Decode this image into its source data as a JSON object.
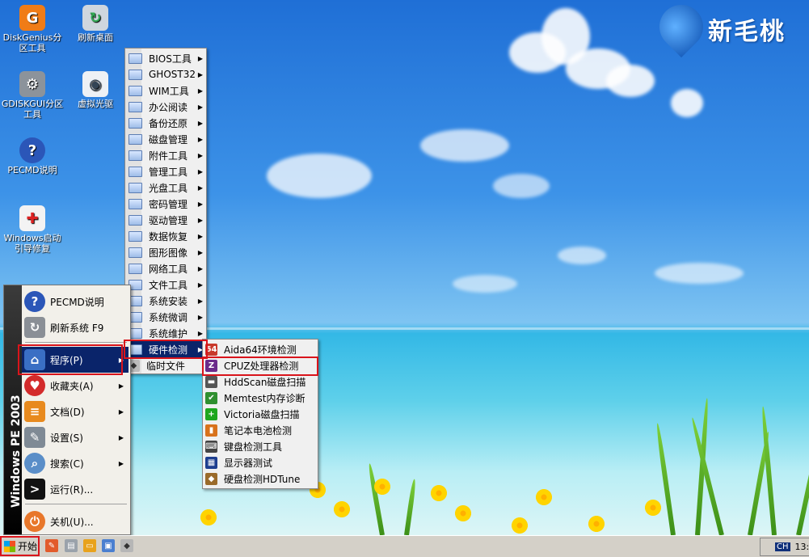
{
  "brand": {
    "text": "新毛桃"
  },
  "desktop_icons": [
    {
      "label": "DiskGenius分区工具",
      "icon": "diskgenius-icon"
    },
    {
      "label": "刷新桌面",
      "icon": "refresh-desktop-icon"
    },
    {
      "label": "GDISKGUI分区工具",
      "icon": "gdisk-icon"
    },
    {
      "label": "虚拟光驱",
      "icon": "virtual-drive-icon"
    },
    {
      "label": "PECMD说明",
      "icon": "help-icon"
    },
    {
      "label": "Windows启动引导修复",
      "icon": "boot-repair-icon"
    }
  ],
  "start_menu": {
    "banner": "Windows PE 2003",
    "items": [
      {
        "label": "PECMD说明",
        "icon": "help-icon",
        "submenu": false
      },
      {
        "label": "刷新系统 F9",
        "icon": "refresh-system-icon",
        "submenu": false
      },
      {
        "label": "程序(P)",
        "icon": "programs-icon",
        "submenu": true
      },
      {
        "label": "收藏夹(A)",
        "icon": "favorites-icon",
        "submenu": true
      },
      {
        "label": "文档(D)",
        "icon": "documents-icon",
        "submenu": true
      },
      {
        "label": "设置(S)",
        "icon": "settings-icon",
        "submenu": true
      },
      {
        "label": "搜索(C)",
        "icon": "search-icon",
        "submenu": true
      },
      {
        "label": "运行(R)...",
        "icon": "run-icon",
        "submenu": false
      },
      {
        "label": "关机(U)...",
        "icon": "shutdown-icon",
        "submenu": false
      }
    ]
  },
  "programs_menu": {
    "items": [
      {
        "label": "BIOS工具"
      },
      {
        "label": "GHOST32"
      },
      {
        "label": "WIM工具"
      },
      {
        "label": "办公阅读"
      },
      {
        "label": "备份还原"
      },
      {
        "label": "磁盘管理"
      },
      {
        "label": "附件工具"
      },
      {
        "label": "管理工具"
      },
      {
        "label": "光盘工具"
      },
      {
        "label": "密码管理"
      },
      {
        "label": "驱动管理"
      },
      {
        "label": "数据恢复"
      },
      {
        "label": "图形图像"
      },
      {
        "label": "网络工具"
      },
      {
        "label": "文件工具"
      },
      {
        "label": "系统安装"
      },
      {
        "label": "系统微调"
      },
      {
        "label": "系统维护"
      },
      {
        "label": "硬件检测"
      },
      {
        "label": "临时文件"
      }
    ]
  },
  "hardware_menu": {
    "items": [
      {
        "label": "Aida64环境检测",
        "icon": "aida64-icon",
        "glyph": "64"
      },
      {
        "label": "CPUZ处理器检测",
        "icon": "cpuz-icon",
        "glyph": "Z"
      },
      {
        "label": "HddScan磁盘扫描",
        "icon": "hddscan-icon",
        "glyph": "▬"
      },
      {
        "label": "Memtest内存诊断",
        "icon": "memtest-icon",
        "glyph": "✔"
      },
      {
        "label": "Victoria磁盘扫描",
        "icon": "victoria-icon",
        "glyph": "+"
      },
      {
        "label": "笔记本电池检测",
        "icon": "battery-icon",
        "glyph": "▮"
      },
      {
        "label": "键盘检测工具",
        "icon": "keyboard-icon",
        "glyph": "⌨"
      },
      {
        "label": "显示器测试",
        "icon": "monitor-icon",
        "glyph": "▦"
      },
      {
        "label": "硬盘检测HDTune",
        "icon": "hdtune-icon",
        "glyph": "◆"
      }
    ]
  },
  "taskbar": {
    "start_label": "开始",
    "language": "CH",
    "clock": "13:"
  },
  "colors": {
    "selection": "#0a246a",
    "highlight_box": "#d9141b"
  }
}
